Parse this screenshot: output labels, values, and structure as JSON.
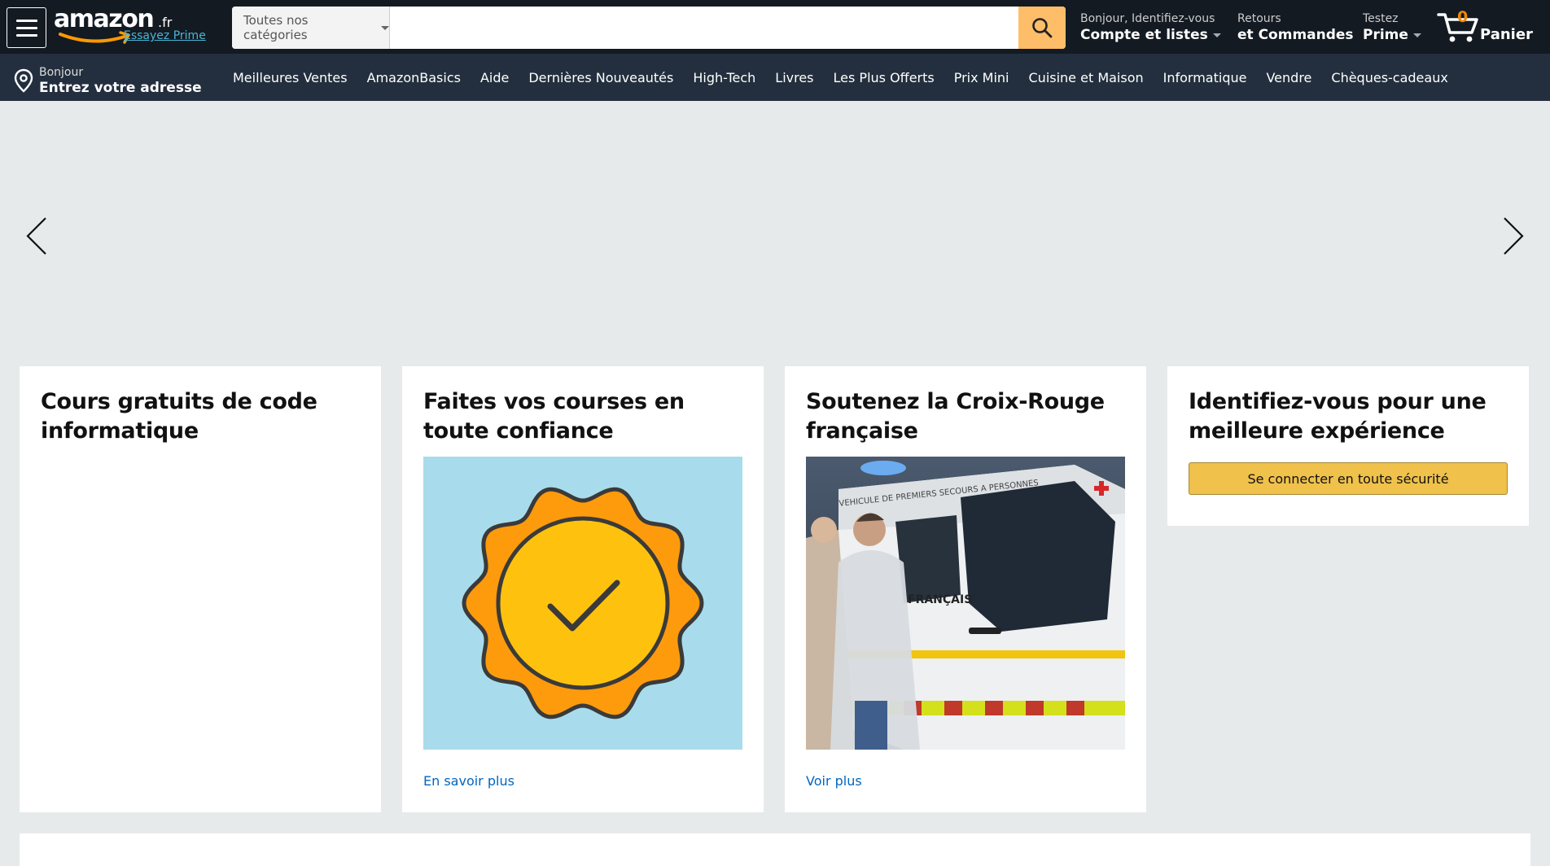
{
  "header": {
    "logo": {
      "wordmark": "amazon",
      "tld": ".fr",
      "prime_link": "Essayez Prime"
    },
    "search": {
      "category": "Toutes nos catégories",
      "placeholder": "",
      "value": ""
    },
    "account": {
      "line1": "Bonjour, Identifiez-vous",
      "line2": "Compte et listes"
    },
    "orders": {
      "line1": "Retours",
      "line2": "et Commandes"
    },
    "prime": {
      "line1": "Testez",
      "line2": "Prime"
    },
    "cart": {
      "count": "0",
      "label": "Panier"
    }
  },
  "subnav": {
    "address": {
      "line1": "Bonjour",
      "line2": "Entrez votre adresse"
    },
    "links": [
      "Meilleures Ventes",
      "AmazonBasics",
      "Aide",
      "Dernières Nouveautés",
      "High-Tech",
      "Livres",
      "Les Plus Offerts",
      "Prix Mini",
      "Cuisine et Maison",
      "Informatique",
      "Vendre",
      "Chèques-cadeaux"
    ]
  },
  "cards": [
    {
      "title": "Cours gratuits de code informatique"
    },
    {
      "title": "Faites vos courses en toute confiance",
      "link": "En savoir plus"
    },
    {
      "title": "Soutenez la Croix-Rouge française",
      "link": "Voir plus",
      "image_text": "VEHICULE DE PREMIERS SECOURS A PERSONNES",
      "image_side_text": "FRANÇAIS"
    },
    {
      "title": "Identifiez-vous pour une meilleure expérience",
      "button": "Se connecter en toute sécurité"
    }
  ],
  "colors": {
    "header_bg": "#131a22",
    "subnav_bg": "#232f3e",
    "search_button": "#febd69",
    "page_bg": "#e6eaeb",
    "link": "#0066c0",
    "signin_button": "#f0c14b",
    "cart_count": "#f08804",
    "prime_link": "#4ab6d8"
  },
  "icons": [
    "hamburger-menu-icon",
    "search-icon",
    "cart-icon",
    "location-pin-icon",
    "chevron-left-icon",
    "chevron-right-icon",
    "trust-badge-icon"
  ]
}
